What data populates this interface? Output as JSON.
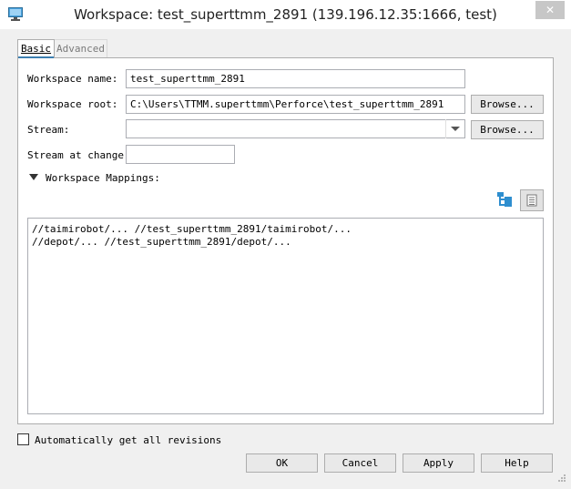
{
  "window": {
    "title": "Workspace: test_superttmm_2891 (139.196.12.35:1666,  test)",
    "close_glyph": "✕"
  },
  "tabs": [
    {
      "label": "Basic",
      "active": true
    },
    {
      "label": "Advanced",
      "active": false
    }
  ],
  "form": {
    "workspace_name_label": "Workspace name:",
    "workspace_name_value": "test_superttmm_2891",
    "workspace_root_label": "Workspace root:",
    "workspace_root_value": "C:\\Users\\TTMM.superttmm\\Perforce\\test_superttmm_2891",
    "browse_label": "Browse...",
    "stream_label": "Stream:",
    "stream_value": "",
    "stream_at_change_label": "Stream at change:",
    "stream_at_change_value": ""
  },
  "mappings": {
    "section_label": "Workspace Mappings:",
    "lines": [
      "//taimirobot/... //test_superttmm_2891/taimirobot/...",
      "//depot/... //test_superttmm_2891/depot/..."
    ]
  },
  "options": {
    "auto_get_label": "Automatically get all revisions",
    "auto_get_checked": false
  },
  "buttons": {
    "ok": "OK",
    "cancel": "Cancel",
    "apply": "Apply",
    "help": "Help"
  },
  "icons": {
    "app": "monitor-icon",
    "tree_view": "tree-view-icon",
    "text_view": "text-view-icon"
  },
  "colors": {
    "accent": "#3c7fb1",
    "tree_icon": "#2e8ecf"
  }
}
